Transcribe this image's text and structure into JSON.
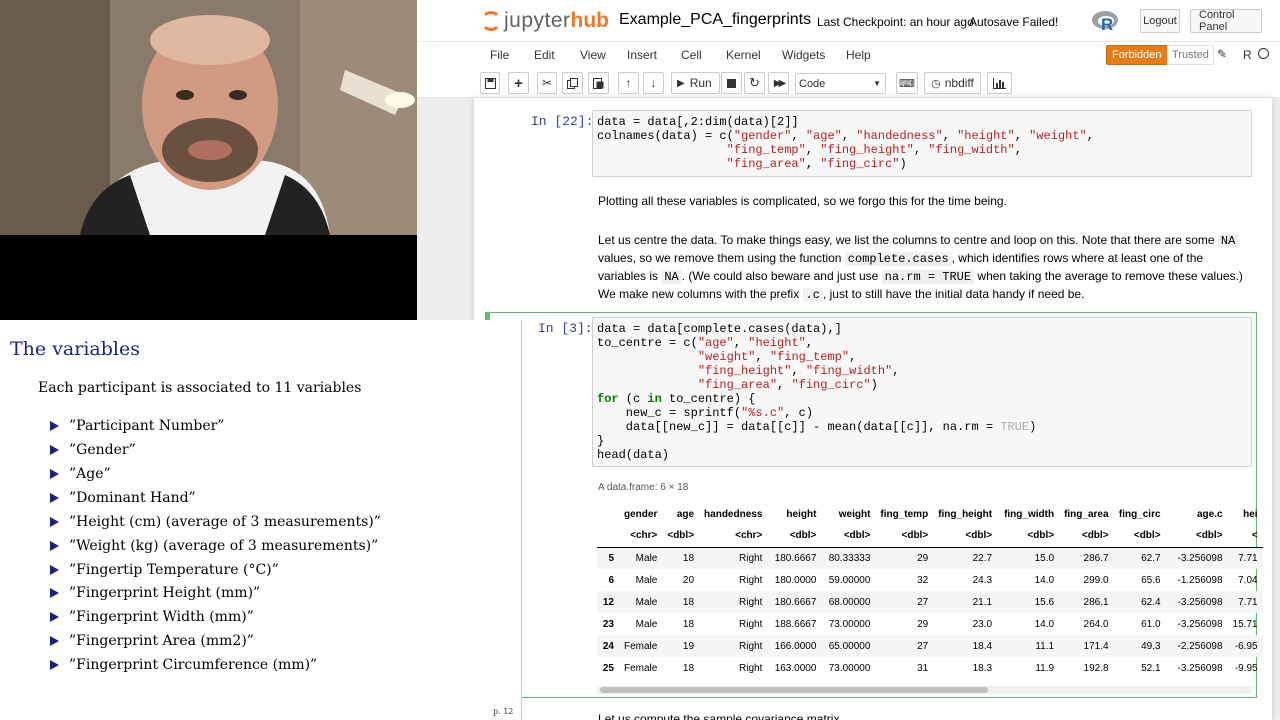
{
  "header": {
    "logo_jupyter": "jupyter",
    "logo_hub": "hub",
    "notebook_name": "Example_PCA_fingerprints",
    "checkpoint": "Last Checkpoint: an hour ago",
    "autosave": "Autosave Failed!",
    "logout": "Logout",
    "control_panel": "Control Panel"
  },
  "menu": {
    "items": [
      "File",
      "Edit",
      "View",
      "Insert",
      "Cell",
      "Kernel",
      "Widgets",
      "Help"
    ],
    "forbidden": "Forbidden",
    "trusted": "Trusted",
    "kernel": "R"
  },
  "toolbar": {
    "run": "Run",
    "cell_type": "Code",
    "nbdiff": "nbdiff"
  },
  "cells": {
    "c22": {
      "prompt": "In [22]:",
      "lines": [
        [
          "data = data[,2:dim(data)[2]]"
        ],
        [
          "colnames(data) = c(",
          "\"gender\"",
          ", ",
          "\"age\"",
          ", ",
          "\"handedness\"",
          ", ",
          "\"height\"",
          ", ",
          "\"weight\"",
          ","
        ],
        [
          "                  ",
          "\"fing_temp\"",
          ", ",
          "\"fing_height\"",
          ", ",
          "\"fing_width\"",
          ","
        ],
        [
          "                  ",
          "\"fing_area\"",
          ", ",
          "\"fing_circ\"",
          ")"
        ]
      ]
    },
    "md1": "Plotting all these variables is complicated, so we forgo this for the time being.",
    "md2": {
      "t1": "Let us centre the data. To make things easy, we list the columns to centre and loop on this. Note that there are some ",
      "c1": "NA",
      "t2": "values, so we remove them using the function ",
      "c2": "complete.cases",
      "t3": ", which identifies rows where at least one of the",
      "t4": "variables is ",
      "c3": "NA",
      "t5": ". (We could also beware and just use ",
      "c4": "na.rm = TRUE",
      "t6": " when taking the average to remove these values.)",
      "t7": "We make new columns with the prefix ",
      "c5": ".c",
      "t8": ", just to still have the initial data handy if need be."
    },
    "c3": {
      "prompt": "In [3]:",
      "l1": "data = data[complete.cases(data),]",
      "l2a": "to_centre = c(",
      "l2b": "\"age\"",
      "l2c": ", ",
      "l2d": "\"height\"",
      "l2e": ",",
      "l3a": "              ",
      "l3b": "\"weight\"",
      "l3c": ", ",
      "l3d": "\"fing_temp\"",
      "l3e": ",",
      "l4a": "              ",
      "l4b": "\"fing_height\"",
      "l4c": ", ",
      "l4d": "\"fing_width\"",
      "l4e": ",",
      "l5a": "              ",
      "l5b": "\"fing_area\"",
      "l5c": ", ",
      "l5d": "\"fing_circ\"",
      "l5e": ")",
      "l6a": "for",
      "l6b": " (c ",
      "l6c": "in",
      "l6d": " to_centre) {",
      "l7a": "    new_c = sprintf(",
      "l7b": "\"%s.c\"",
      "l7c": ", c)",
      "l8a": "    data[[new_c]] = data[[c]] - mean(data[[c]], na.rm = ",
      "l8b": "TRUE",
      "l8c": ")",
      "l9": "}",
      "l10": "head(data)"
    },
    "output": {
      "caption": "A data.frame: 6 × 18",
      "columns": [
        "",
        "gender",
        "age",
        "handedness",
        "height",
        "weight",
        "fing_temp",
        "fing_height",
        "fing_width",
        "fing_area",
        "fing_circ",
        "age.c",
        "hei"
      ],
      "types": [
        "",
        "<chr>",
        "<dbl>",
        "<chr>",
        "<dbl>",
        "<dbl>",
        "<dbl>",
        "<dbl>",
        "<dbl>",
        "<dbl>",
        "<dbl>",
        "<dbl>",
        "<"
      ],
      "rows": [
        [
          "5",
          "Male",
          "18",
          "Right",
          "180.6667",
          "80.33333",
          "29",
          "22.7",
          "15.0",
          "286.7",
          "62.7",
          "-3.256098",
          "7.71"
        ],
        [
          "6",
          "Male",
          "20",
          "Right",
          "180.0000",
          "59.00000",
          "32",
          "24.3",
          "14.0",
          "299.0",
          "65.6",
          "-1.256098",
          "7.04"
        ],
        [
          "12",
          "Male",
          "18",
          "Right",
          "180.6667",
          "68.00000",
          "27",
          "21.1",
          "15.6",
          "286.1",
          "62.4",
          "-3.256098",
          "7.71"
        ],
        [
          "23",
          "Male",
          "18",
          "Right",
          "188.6667",
          "73.00000",
          "29",
          "23.0",
          "14.0",
          "264.0",
          "61.0",
          "-3.256098",
          "15.71"
        ],
        [
          "24",
          "Female",
          "19",
          "Right",
          "166.0000",
          "65.00000",
          "27",
          "18.4",
          "11.1",
          "171.4",
          "49.3",
          "-2.256098",
          "-6.95"
        ],
        [
          "25",
          "Female",
          "18",
          "Right",
          "163.0000",
          "73.00000",
          "31",
          "18.3",
          "11.9",
          "192.8",
          "52.1",
          "-3.256098",
          "-9.95"
        ]
      ]
    },
    "cut_text": "Let us compute the sample covariance matrix"
  },
  "slide": {
    "title": "The variables",
    "intro": "Each participant is associated to 11 variables",
    "bullets": [
      "”Participant Number”",
      "”Gender”",
      "”Age”",
      "”Dominant Hand”",
      "”Height (cm) (average of 3 measurements)”",
      "”Weight (kg) (average of 3 measurements)”",
      "”Fingertip Temperature (°C)”",
      "”Fingerprint Height (mm)”",
      "”Fingerprint Width (mm)”",
      "”Fingerprint Area (mm2)”",
      "”Fingerprint Circumference (mm)”"
    ],
    "page": "p. 12"
  },
  "colors": {
    "accent_orange": "#f37726",
    "prompt_blue": "#303f9f",
    "selected_green": "#66bb6a",
    "slide_title": "#1a237e"
  }
}
